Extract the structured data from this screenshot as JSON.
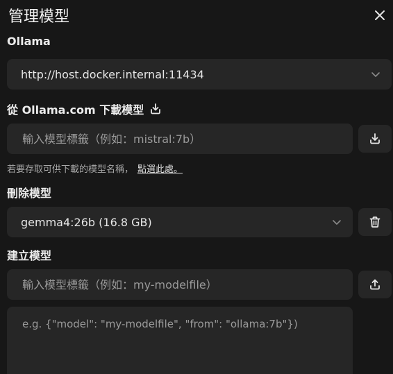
{
  "modal": {
    "title": "管理模型"
  },
  "ollama": {
    "label": "Ollama",
    "url": "http://host.docker.internal:11434"
  },
  "download": {
    "label": "從 Ollama.com 下載模型",
    "placeholder": "輸入模型標籤（例如：mistral:7b）",
    "hint": "若要存取可供下載的模型名稱，",
    "hint_link": "點選此處。"
  },
  "delete": {
    "label": "刪除模型",
    "selected": "gemma4:26b (16.8 GB)"
  },
  "create": {
    "label": "建立模型",
    "tag_placeholder": "輸入模型標籤（例如：my-modelfile）",
    "content_placeholder": "e.g. {\"model\": \"my-modelfile\", \"from\": \"ollama:7b\"})"
  }
}
